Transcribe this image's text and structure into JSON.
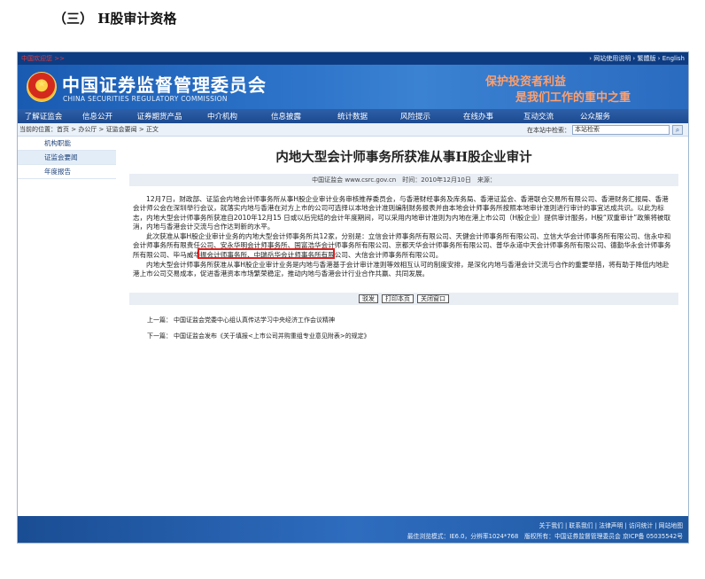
{
  "doc_heading": "（三） H股审计资格",
  "topbar": {
    "welcome": "中国欢迎您 >>",
    "links": "› 网站使用说明 › 繁體版 › English"
  },
  "banner": {
    "title_cn": "中国证券监督管理委员会",
    "title_en": "CHINA SECURITIES REGULATORY COMMISSION",
    "slogan_line1": "保护投资者利益",
    "slogan_line2": "是我们工作的重中之重"
  },
  "nav": [
    "了解证监会",
    "信息公开",
    "证券期货产品",
    "中介机构",
    "信息披露",
    "统计数据",
    "风险提示",
    "在线办事",
    "互动交流",
    "公众服务"
  ],
  "breadcrumb": "当前的位置：首页 > 办公厅 > 证监会要闻 > 正文",
  "search": {
    "label": "在本站中检索：",
    "placeholder": "本站检索"
  },
  "sidebar": [
    {
      "label": "机构职能"
    },
    {
      "label": "证监会要闻"
    },
    {
      "label": "年度报告"
    }
  ],
  "article": {
    "title": "内地大型会计师事务所获准从事H股企业审计",
    "meta": "中国证监会 www.csrc.gov.cn　时间：2010年12月10日　来源：",
    "paragraphs": [
      "12月7日，财政部、证监会内地会计师事务所从事H股企业审计业务审核推荐委员会，与香港财经事务及库务局、香港证监会、香港联合交易所有限公司、香港财务汇报局、香港会计师公会在深圳举行会议，就落实内地与香港在对方上市的公司可选择以本地会计准则编制财务报表并由本地会计师事务所按照本地审计准则进行审计的事宜达成共识。以此为标志，内地大型会计师事务所获准自2010年12月15 日或以后完结的会计年度期间，可以采用内地审计准则为内地在港上市公司（H股企业）提供审计服务，H股“双重审计”政策将被取消，内地与香港会计交流与合作达到新的水平。",
      "此次获准从事H股企业审计业务的内地大型会计师事务所共12家，分别是：立信会计师事务所有限公司、天健会计师事务所有限公司、立信大华会计师事务所有限公司、信永中和会计师事务所有限责任公司、安永华明会计师事务所、国富浩华会计师事务所有限公司、京都天华会计师事务所有限公司、普华永道中天会计师事务所有限公司、德勤华永会计师事务所有限公司、毕马威华振会计师事务所、中瑞岳华会计师事务所有限公司、大信会计师事务所有限公司。",
      "内地大型会计师事务所获准从事H股企业审计业务是内地与香港基于会计审计准则等效相互认可的制度安排，是深化内地与香港会计交流与合作的重要举措，将有助于降低内地赴港上市公司交易成本，促进香港资本市场繁荣稳定，推动内地与香港会计行业合作共赢、共同发展。"
    ],
    "buttons": [
      "驳发",
      "打印本页",
      "关闭窗口"
    ],
    "prev_label": "上一篇：",
    "prev_text": "中国证监会党委中心组认真传达学习中央经济工作会议精神",
    "next_label": "下一篇：",
    "next_text": "中国证监会发布《关于填报<上市公司并购重组专业意见附表>的规定》"
  },
  "footer": {
    "links": "关于我们 | 联系我们 | 法律声明 | 访问统计 | 网站地图",
    "info": "最佳浏览模式：IE6.0，分辨率1024*768　版权所有：中国证券监督管理委员会 京ICP备 05035542号"
  },
  "colors": {
    "frame_blue": "#1d4a90",
    "highlight_red": "#e02020",
    "slogan_orange": "#ff9f6b"
  }
}
